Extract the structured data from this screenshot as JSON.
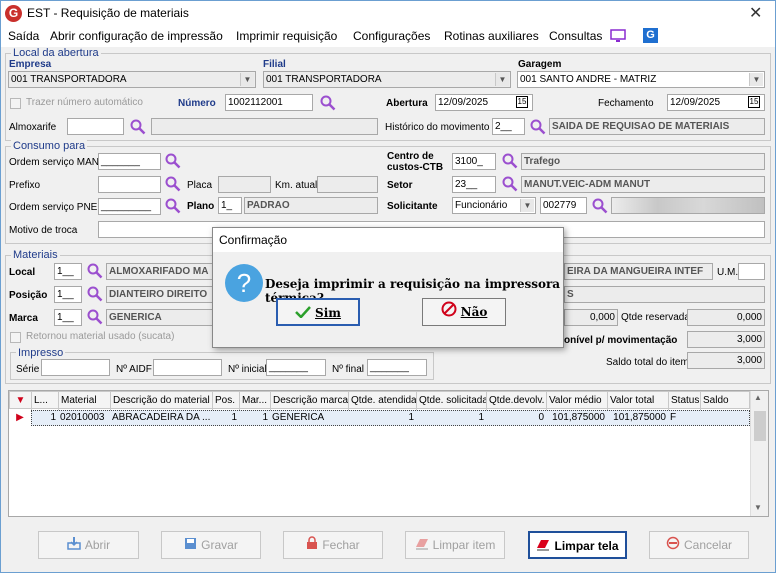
{
  "window": {
    "title": "EST - Requisição de materiais"
  },
  "menu": [
    "Saída",
    "Abrir configuração de impressão",
    "Imprimir requisição",
    "Configurações",
    "Rotinas auxiliares",
    "Consultas"
  ],
  "local_abertura": {
    "legend": "Local da abertura",
    "empresa_label": "Empresa",
    "empresa_value": "001 TRANSPORTADORA",
    "filial_label": "Filial",
    "filial_value": "001 TRANSPORTADORA",
    "garagem_label": "Garagem",
    "garagem_value": "001 SANTO ANDRE - MATRIZ",
    "trazer_label": "Trazer número automático",
    "numero_label": "Número",
    "numero_value": "1002112001",
    "abertura_label": "Abertura",
    "abertura_value": "12/09/2025",
    "fechamento_label": "Fechamento",
    "fechamento_value": "12/09/2025",
    "almoxarife_label": "Almoxarife",
    "almoxarife_value": "",
    "historico_label": "Histórico do movimento",
    "historico_code": "2__",
    "historico_desc": "SAIDA DE REQUISAO DE MATERIAIS"
  },
  "consumo": {
    "legend": "Consumo para",
    "os_man_label": "Ordem serviço MAN",
    "os_man_value": "_______",
    "centro_label_1": "Centro de",
    "centro_label_2": "custos-CTB",
    "centro_code": "3100_",
    "centro_desc": "Trafego",
    "prefixo_label": "Prefixo",
    "placa_label": "Placa",
    "km_label": "Km. atual",
    "setor_label": "Setor",
    "setor_code": "23__",
    "setor_desc": "MANUT.VEIC-ADM MANUT",
    "os_pne_label": "Ordem serviço PNE",
    "os_pne_value": "_________",
    "plano_label": "Plano",
    "plano_code": "1_",
    "plano_desc": "PADRAO",
    "solicitante_label": "Solicitante",
    "solicitante_type": "Funcionário",
    "solicitante_code": "002779",
    "motivo_label": "Motivo de troca"
  },
  "materiais": {
    "legend": "Materiais",
    "local_label": "Local",
    "local_code": "1__",
    "local_desc": "ALMOXARIFADO MA",
    "local_right_desc": "EIRA DA MANGUEIRA INTEF",
    "um_label": "U.M.",
    "posicao_label": "Posição",
    "posicao_code": "1__",
    "posicao_desc": "DIANTEIRO DIREITO",
    "posicao_right_desc": "S",
    "marca_label": "Marca",
    "marca_code": "1__",
    "marca_desc": "GENERICA",
    "marca_qty": "0,000",
    "qtde_reservada_label": "Qtde reservada",
    "qtde_reservada_value": "0,000",
    "retornou_label": "Retornou material usado (sucata)",
    "disponivel_label": "onível p/ movimentação",
    "disponivel_value": "3,000",
    "saldo_total_label": "Saldo total do item",
    "saldo_total_value": "3,000"
  },
  "impresso": {
    "legend": "Impresso",
    "serie_label": "Série",
    "aidf_label": "Nº AIDF",
    "inicial_label": "Nº inicial",
    "inicial_value": "_______",
    "final_label": "Nº final",
    "final_value": "_______"
  },
  "grid": {
    "headers": [
      "L...",
      "Material",
      "Descrição do material",
      "Pos.",
      "Mar...",
      "Descrição marca",
      "Qtde. atendida",
      "Qtde. solicitada",
      "Qtde.devolv.",
      "Valor médio",
      "Valor total",
      "Status",
      "Saldo"
    ],
    "row": [
      "1",
      "02010003",
      "ABRACADEIRA DA ...",
      "1",
      "1",
      "GENERICA",
      "1",
      "1",
      "0",
      "101,875000",
      "101,875000",
      "F",
      ""
    ]
  },
  "buttons": {
    "abrir": "Abrir",
    "gravar": "Gravar",
    "fechar": "Fechar",
    "limpar_item": "Limpar item",
    "limpar_tela": "Limpar tela",
    "cancelar": "Cancelar"
  },
  "dialog": {
    "title": "Confirmação",
    "message": "Deseja imprimir a requisição na impressora térmica?",
    "yes": "Sim",
    "no": "Não"
  },
  "colors": {
    "accent": "#1f3b8a",
    "magnifier": "#9b4fcf",
    "dialog_icon": "#4aa3e0"
  }
}
